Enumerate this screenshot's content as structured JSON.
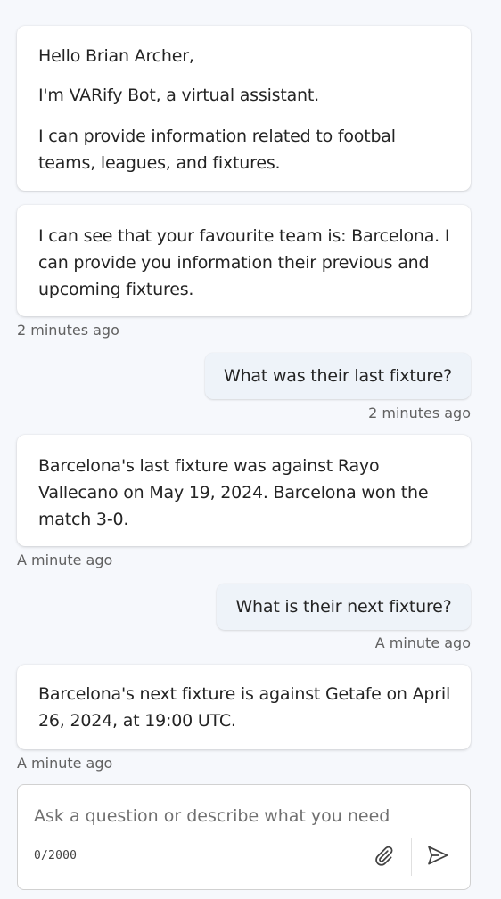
{
  "messages": [
    {
      "role": "bot",
      "paragraphs": [
        "Hello Brian Archer,",
        "I'm VARify Bot, a virtual assistant.",
        "I can provide information related to footbal teams, leagues, and fixtures."
      ]
    },
    {
      "role": "bot",
      "paragraphs": [
        "I can see that your favourite team is: Barcelona. I can provide you information their previous and upcoming fixtures."
      ],
      "timestamp": "2 minutes ago"
    },
    {
      "role": "user",
      "text": "What was their last fixture?",
      "timestamp": "2 minutes ago"
    },
    {
      "role": "bot",
      "paragraphs": [
        "Barcelona's last fixture was against Rayo Vallecano on May 19, 2024. Barcelona won the match 3-0."
      ],
      "timestamp": "A minute ago"
    },
    {
      "role": "user",
      "text": "What is their next fixture?",
      "timestamp": "A minute ago"
    },
    {
      "role": "bot",
      "paragraphs": [
        "Barcelona's next fixture is against Getafe on April 26, 2024, at 19:00 UTC."
      ],
      "timestamp": "A minute ago"
    }
  ],
  "composer": {
    "placeholder": "Ask a question or describe what you need",
    "value": "",
    "counter": "0/2000",
    "attach_icon": "paperclip-icon",
    "send_icon": "send-icon"
  }
}
